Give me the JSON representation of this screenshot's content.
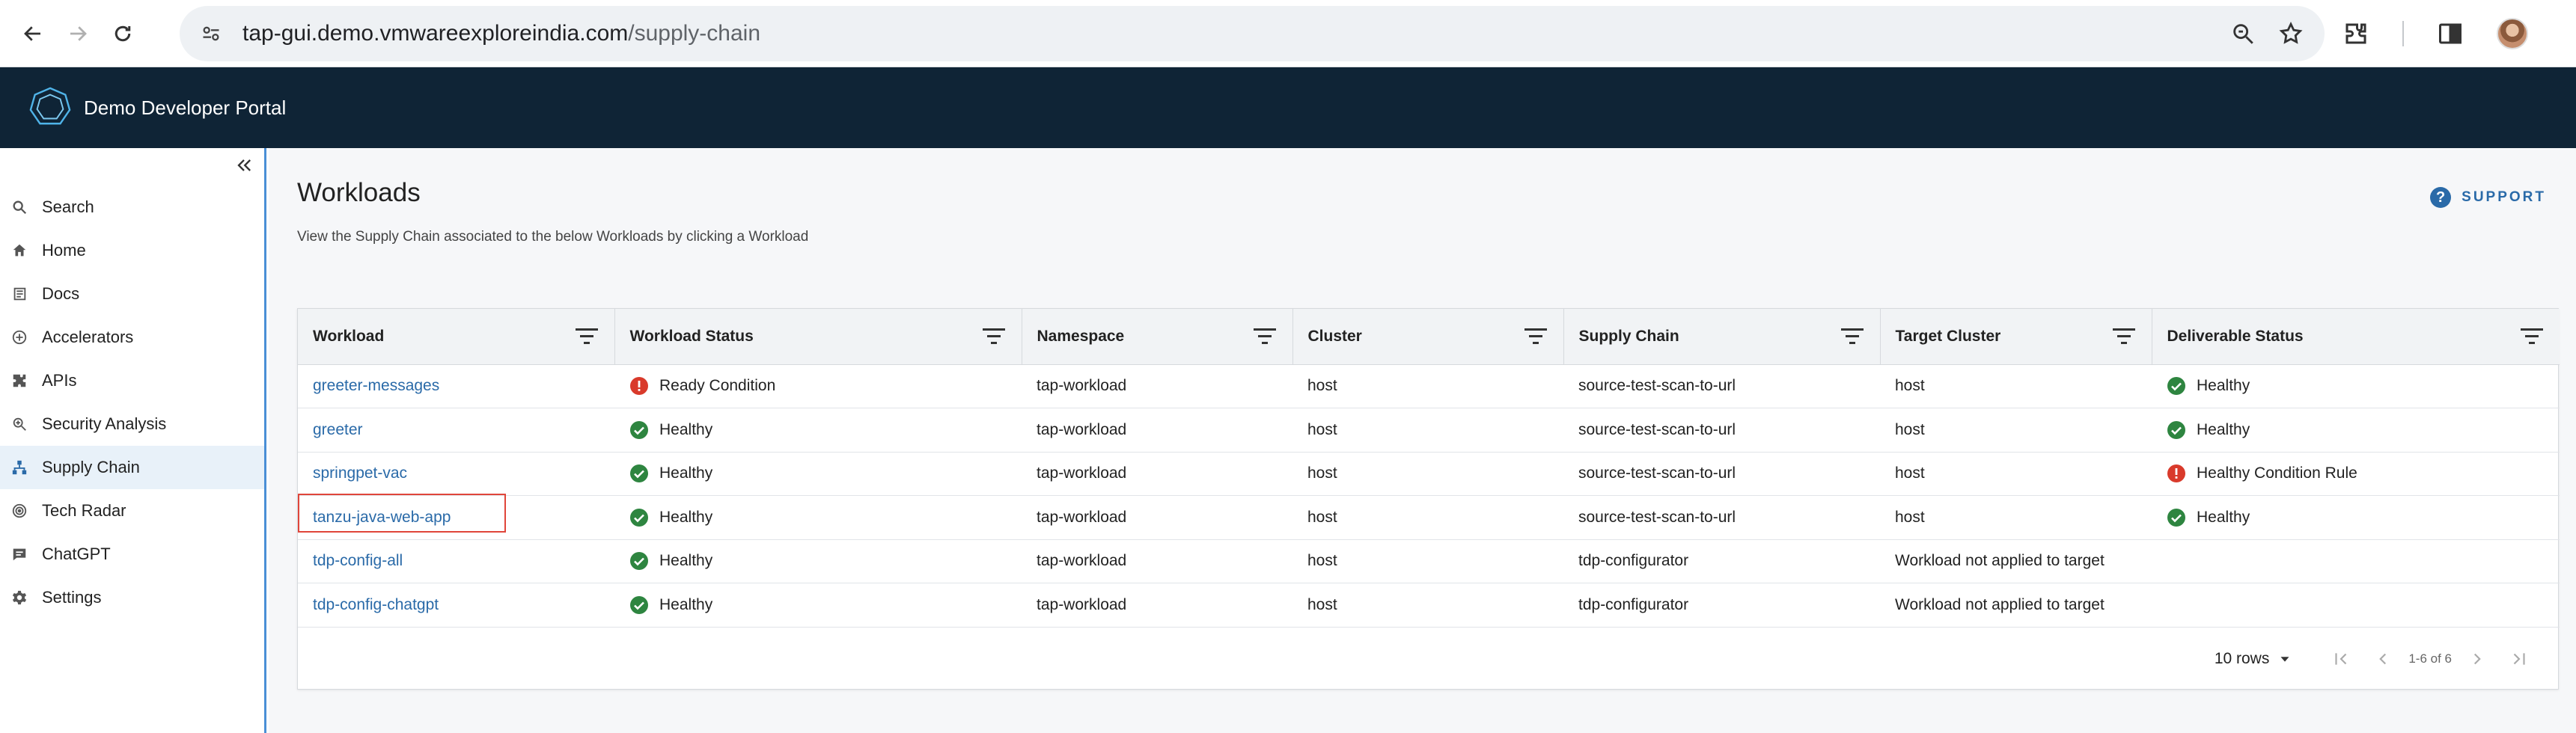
{
  "browser": {
    "url_host": "tap-gui.demo.vmwareexploreindia.com",
    "url_path": "/supply-chain"
  },
  "app": {
    "title": "Demo Developer Portal"
  },
  "sidebar": {
    "items": [
      {
        "label": "Search",
        "icon": "search-icon"
      },
      {
        "label": "Home",
        "icon": "home-icon"
      },
      {
        "label": "Docs",
        "icon": "docs-icon"
      },
      {
        "label": "Accelerators",
        "icon": "plus-circle-icon"
      },
      {
        "label": "APIs",
        "icon": "puzzle-icon"
      },
      {
        "label": "Security Analysis",
        "icon": "security-icon"
      },
      {
        "label": "Supply Chain",
        "icon": "supply-chain-icon",
        "active": true
      },
      {
        "label": "Tech Radar",
        "icon": "radar-icon"
      },
      {
        "label": "ChatGPT",
        "icon": "chat-icon"
      },
      {
        "label": "Settings",
        "icon": "gear-icon"
      }
    ]
  },
  "page": {
    "title": "Workloads",
    "subtitle": "View the Supply Chain associated to the below Workloads by clicking a Workload",
    "support_label": "SUPPORT"
  },
  "table": {
    "columns": [
      "Workload",
      "Workload Status",
      "Namespace",
      "Cluster",
      "Supply Chain",
      "Target Cluster",
      "Deliverable Status"
    ],
    "rows": [
      {
        "workload": "greeter-messages",
        "workload_status": "Ready Condition",
        "workload_status_type": "error",
        "namespace": "tap-workload",
        "cluster": "host",
        "supply_chain": "source-test-scan-to-url",
        "target_cluster": "host",
        "deliverable_status": "Healthy",
        "deliverable_status_type": "ok"
      },
      {
        "workload": "greeter",
        "workload_status": "Healthy",
        "workload_status_type": "ok",
        "namespace": "tap-workload",
        "cluster": "host",
        "supply_chain": "source-test-scan-to-url",
        "target_cluster": "host",
        "deliverable_status": "Healthy",
        "deliverable_status_type": "ok"
      },
      {
        "workload": "springpet-vac",
        "workload_status": "Healthy",
        "workload_status_type": "ok",
        "namespace": "tap-workload",
        "cluster": "host",
        "supply_chain": "source-test-scan-to-url",
        "target_cluster": "host",
        "deliverable_status": "Healthy Condition Rule",
        "deliverable_status_type": "error"
      },
      {
        "workload": "tanzu-java-web-app",
        "workload_status": "Healthy",
        "workload_status_type": "ok",
        "namespace": "tap-workload",
        "cluster": "host",
        "supply_chain": "source-test-scan-to-url",
        "target_cluster": "host",
        "deliverable_status": "Healthy",
        "deliverable_status_type": "ok"
      },
      {
        "workload": "tdp-config-all",
        "workload_status": "Healthy",
        "workload_status_type": "ok",
        "namespace": "tap-workload",
        "cluster": "host",
        "supply_chain": "tdp-configurator",
        "target_cluster": "Workload not applied to target",
        "deliverable_status": "",
        "deliverable_status_type": "none"
      },
      {
        "workload": "tdp-config-chatgpt",
        "workload_status": "Healthy",
        "workload_status_type": "ok",
        "namespace": "tap-workload",
        "cluster": "host",
        "supply_chain": "tdp-configurator",
        "target_cluster": "Workload not applied to target",
        "deliverable_status": "",
        "deliverable_status_type": "none"
      }
    ]
  },
  "pager": {
    "rows_label": "10 rows",
    "range": "1-6 of 6"
  },
  "colors": {
    "ok": "#2e8540",
    "error": "#d93a2b",
    "link": "#2a6aa8",
    "header_bg": "#0f2436"
  }
}
